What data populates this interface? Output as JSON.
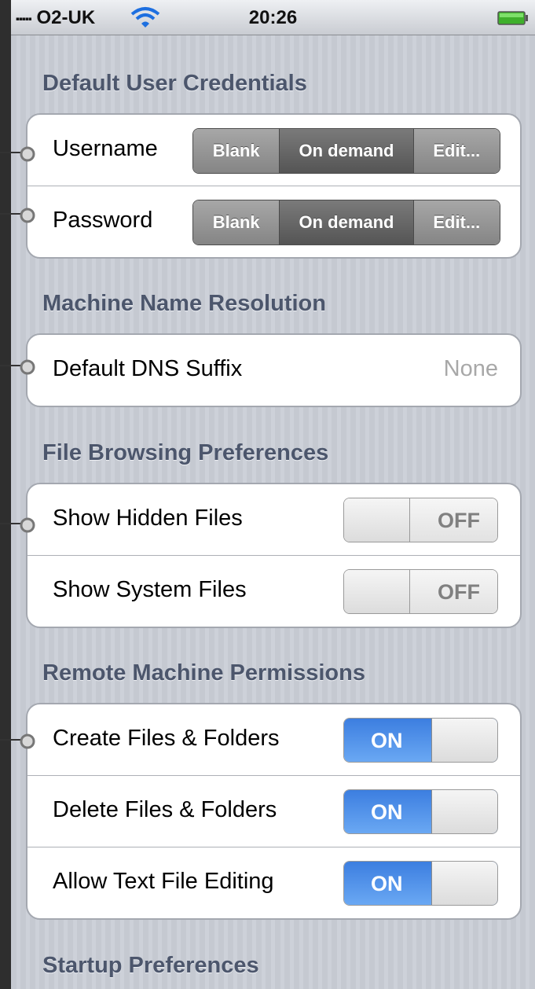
{
  "status": {
    "carrier": "O2-UK",
    "time": "20:26",
    "icons": [
      "signal-icon",
      "wifi-icon",
      "battery-icon"
    ]
  },
  "sections": {
    "credentials": {
      "header": "Default User Credentials",
      "rows": [
        {
          "label": "Username",
          "segments": [
            "Blank",
            "On demand",
            "Edit..."
          ],
          "selected": "On demand"
        },
        {
          "label": "Password",
          "segments": [
            "Blank",
            "On demand",
            "Edit..."
          ],
          "selected": "On demand"
        }
      ]
    },
    "resolution": {
      "header": "Machine Name Resolution",
      "rows": [
        {
          "label": "Default DNS Suffix",
          "value": "None"
        }
      ]
    },
    "browsing": {
      "header": "File Browsing Preferences",
      "rows": [
        {
          "label": "Show Hidden Files",
          "toggle": "OFF"
        },
        {
          "label": "Show System Files",
          "toggle": "OFF"
        }
      ]
    },
    "permissions": {
      "header": "Remote Machine Permissions",
      "rows": [
        {
          "label": "Create Files & Folders",
          "toggle": "ON"
        },
        {
          "label": "Delete Files & Folders",
          "toggle": "ON"
        },
        {
          "label": "Allow Text File Editing",
          "toggle": "ON"
        }
      ]
    },
    "startup": {
      "header": "Startup Preferences"
    }
  },
  "colors": {
    "background": "#c8ccd4",
    "header_text": "#4c566c",
    "toggle_on": "#3c7ee0",
    "segment_selected": "#555555"
  }
}
